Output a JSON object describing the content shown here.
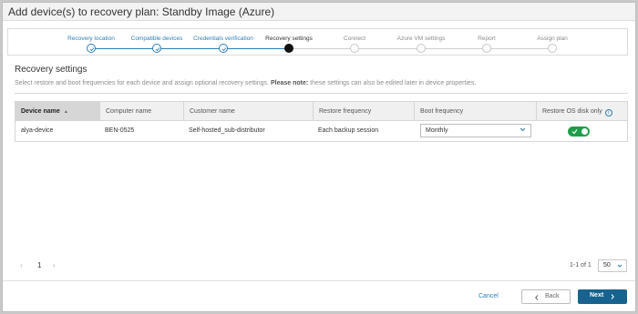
{
  "dialog": {
    "title": "Add device(s) to recovery plan: Standby Image (Azure)"
  },
  "stepper": {
    "steps": [
      {
        "label": "Recovery location",
        "state": "done"
      },
      {
        "label": "Compatible devices",
        "state": "done"
      },
      {
        "label": "Credentials verification",
        "state": "done"
      },
      {
        "label": "Recovery settings",
        "state": "current"
      },
      {
        "label": "Connect",
        "state": "todo"
      },
      {
        "label": "Azure VM settings",
        "state": "todo"
      },
      {
        "label": "Report",
        "state": "todo"
      },
      {
        "label": "Assign plan",
        "state": "todo"
      }
    ]
  },
  "section": {
    "title": "Recovery settings",
    "description_prefix": "Select restore and boot frequencies for each device and assign optional recovery settings.",
    "description_note_label": "Please note:",
    "description_note": "these settings can also be edited later in device properties."
  },
  "table": {
    "columns": [
      "Device name",
      "Computer name",
      "Customer name",
      "Restore frequency",
      "Boot frequency",
      "Restore OS disk only"
    ],
    "sort_column": "Device name",
    "sort_direction": "ascending",
    "rows": [
      {
        "device_name": "alya-device",
        "computer_name": "BEN-0525",
        "customer_name": "Self-hosted_sub-distributor",
        "restore_frequency": "Each backup session",
        "boot_frequency": "Monthly",
        "restore_os_disk_only": true
      }
    ]
  },
  "pagination": {
    "current_page": "1",
    "range_text": "1-1 of 1",
    "per_page": "50"
  },
  "footer": {
    "cancel_label": "Cancel",
    "back_label": "Back",
    "next_label": "Next"
  },
  "colors": {
    "accent": "#2d7fb8",
    "primary_button": "#17638f",
    "toggle_on": "#1e9e4a"
  }
}
